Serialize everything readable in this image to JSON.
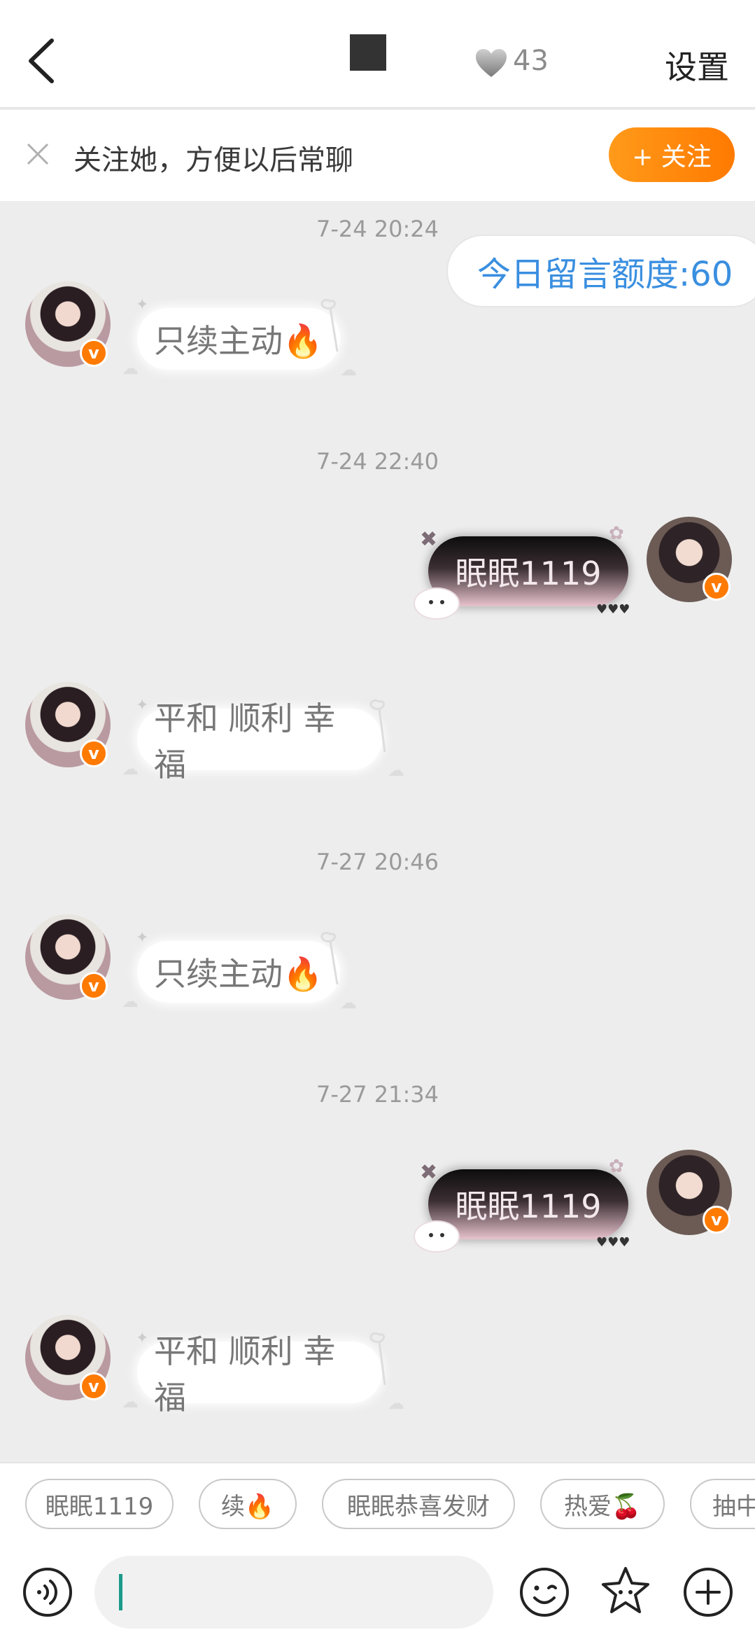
{
  "header": {
    "back_icon": "chevron-left-icon",
    "heart_icon": "heart-icon",
    "heart_count": "43",
    "settings_label": "设置"
  },
  "follow_bar": {
    "close_icon": "close-icon",
    "text": "关注她，方便以后常聊",
    "button_label": "+ 关注",
    "accent": "#ff8a0a"
  },
  "quota": "今日留言额度:60",
  "messages": [
    {
      "time": "7-24 20:24",
      "side": "left",
      "text": "只续主动🔥"
    },
    {
      "time": "7-24 22:40",
      "side": "right",
      "text": "眠眠1119"
    },
    {
      "time": "",
      "side": "left",
      "text": "平和 顺利 幸福"
    },
    {
      "time": "7-27 20:46",
      "side": "left",
      "text": "只续主动🔥"
    },
    {
      "time": "7-27 21:34",
      "side": "right",
      "text": "眠眠1119"
    },
    {
      "time": "",
      "side": "left",
      "text": "平和 顺利 幸福"
    }
  ],
  "chips": [
    "眠眠1119",
    "续🔥",
    "眠眠恭喜发财",
    "热爱🍒",
    "抽中"
  ],
  "input_bar": {
    "voice_icon": "voice-icon",
    "emoji_icon": "emoji-icon",
    "sticker_icon": "star-sticker-icon",
    "plus_icon": "plus-icon",
    "placeholder": ""
  },
  "badge_letter": "v"
}
